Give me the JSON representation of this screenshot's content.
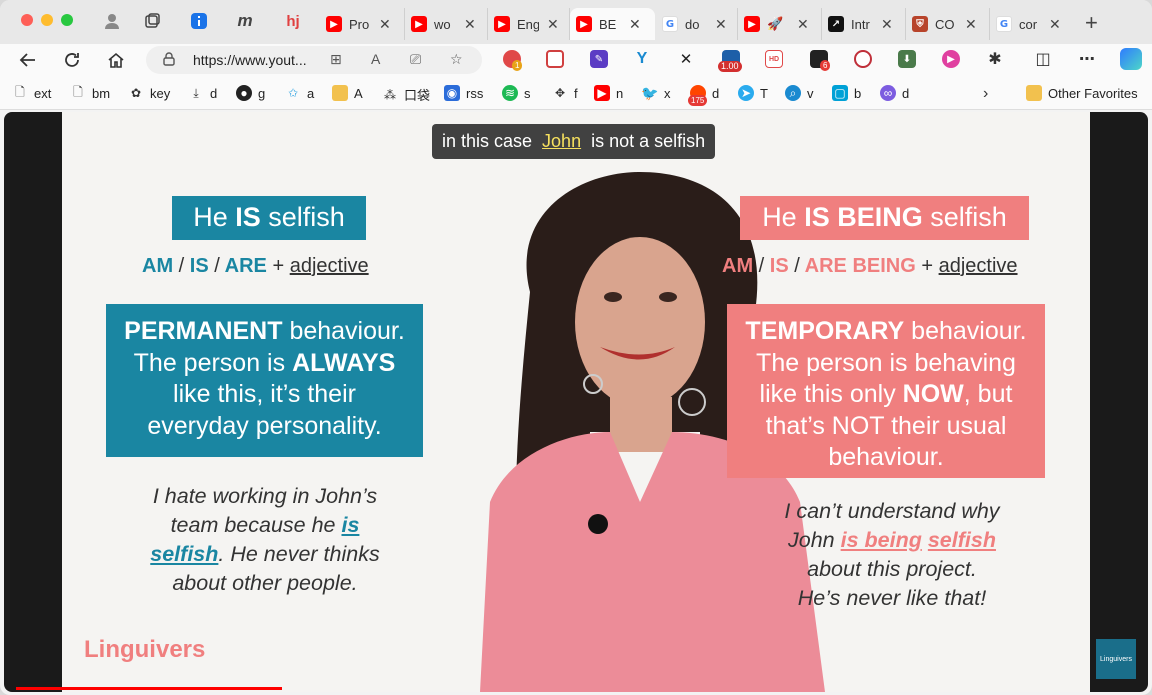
{
  "browser": {
    "tabs": [
      {
        "icon": "youtube-icon",
        "title": "Pro"
      },
      {
        "icon": "youtube-icon",
        "title": "wo"
      },
      {
        "icon": "youtube-icon",
        "title": "Eng"
      },
      {
        "icon": "youtube-icon",
        "title": "BE",
        "active": true
      },
      {
        "icon": "google-icon",
        "title": "do"
      },
      {
        "icon": "youtube-icon",
        "title": "🚀"
      },
      {
        "icon": "arrow-icon",
        "title": "Intr"
      },
      {
        "icon": "shield-icon",
        "title": "CO"
      },
      {
        "icon": "google-icon",
        "title": "cor"
      }
    ],
    "url": "https://www.yout...",
    "extension_badges": {
      "first": "1",
      "speed": "1.00",
      "third": "6"
    },
    "bookmarks": [
      {
        "icon": "page-icon",
        "label": "ext"
      },
      {
        "icon": "page-icon",
        "label": "bm"
      },
      {
        "icon": "puzzle-icon",
        "label": "key"
      },
      {
        "icon": "download-icon",
        "label": "d"
      },
      {
        "icon": "github-icon",
        "label": "g"
      },
      {
        "icon": "star-icon",
        "label": "a"
      },
      {
        "icon": "folder-icon",
        "label": "A"
      },
      {
        "icon": "pocket-icon",
        "label": "口袋"
      },
      {
        "icon": "rss-icon",
        "label": "rss"
      },
      {
        "icon": "spotify-icon",
        "label": "s"
      },
      {
        "icon": "feedly-icon",
        "label": "f"
      },
      {
        "icon": "youtube-icon",
        "label": "n"
      },
      {
        "icon": "twitter-icon",
        "label": "x"
      },
      {
        "icon": "reddit-icon",
        "label": "d",
        "badge": "175"
      },
      {
        "icon": "telegram-icon",
        "label": "T"
      },
      {
        "icon": "search-icon",
        "label": "v"
      },
      {
        "icon": "bili-icon",
        "label": "b"
      },
      {
        "icon": "discord-icon",
        "label": "d"
      }
    ],
    "other_favorites": "Other Favorites"
  },
  "video": {
    "caption_before": "in this case",
    "caption_highlight": "John",
    "caption_after": "is not a selfish",
    "left": {
      "title_prefix": "He ",
      "title_bold": "IS",
      "title_suffix": " selfish",
      "rule_words": [
        "AM",
        "/",
        "IS",
        "/",
        "ARE"
      ],
      "rule_plus": "+",
      "rule_adj": "adjective",
      "box_line1_bold": "PERMANENT",
      "box_line1_rest": " behaviour.",
      "box_line2_pre": "The person is ",
      "box_line2_bold": "ALWAYS",
      "box_line3": "like this, it’s their",
      "box_line4": "everyday personality.",
      "ex_line1": "I hate working in John’s",
      "ex_line2_pre": "team because he ",
      "ex_line2_bold": "is",
      "ex_line3_bold": "selfish",
      "ex_line3_rest": ". He never thinks",
      "ex_line4": "about other people."
    },
    "right": {
      "title_prefix": "He ",
      "title_bold": "IS BEING",
      "title_suffix": " selfish",
      "rule_words": [
        "AM",
        "/",
        "IS",
        "/",
        "ARE BEING"
      ],
      "rule_plus": "+",
      "rule_adj": "adjective",
      "box_line1_bold": "TEMPORARY",
      "box_line1_rest": " behaviour.",
      "box_line2": "The person is behaving",
      "box_line3_pre": "like this only ",
      "box_line3_bold": "NOW",
      "box_line3_rest": ", but",
      "box_line4": "that’s NOT their usual",
      "box_line5": "behaviour.",
      "ex_line1": "I can’t understand why",
      "ex_line2_pre": "John ",
      "ex_line2_bold1": "is being",
      "ex_line2_bold2": "selfish",
      "ex_line3": "about this project.",
      "ex_line4": "He’s never like that!"
    },
    "logo": "Linguivers",
    "corner_logo": "Linguivers",
    "progress": 0.23
  },
  "colors": {
    "teal": "#1a86a2",
    "pink": "#f07f7f",
    "youtube_red": "#ff0000"
  }
}
